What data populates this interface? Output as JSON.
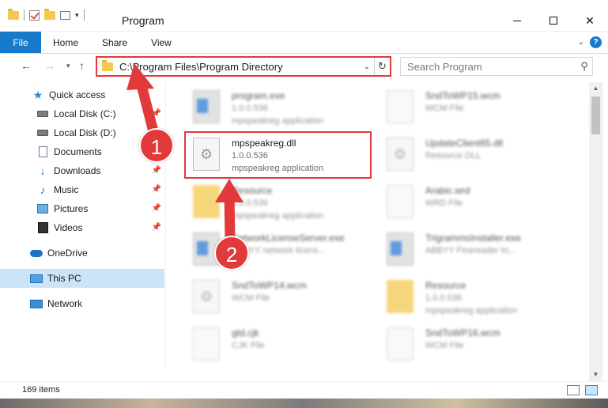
{
  "window": {
    "title": "Program"
  },
  "ribbon": {
    "tabs": [
      "File",
      "Home",
      "Share",
      "View"
    ]
  },
  "nav": {
    "address": "C:\\Program Files\\Program Directory",
    "search_placeholder": "Search Program"
  },
  "sidebar": {
    "items": [
      {
        "label": "Quick access",
        "icon": "star-icon",
        "pinned": false
      },
      {
        "label": "Local Disk (C:)",
        "icon": "disk-icon",
        "pinned": true
      },
      {
        "label": "Local Disk (D:)",
        "icon": "disk-icon",
        "pinned": false
      },
      {
        "label": "Documents",
        "icon": "documents-icon",
        "pinned": true
      },
      {
        "label": "Downloads",
        "icon": "downloads-icon",
        "pinned": true
      },
      {
        "label": "Music",
        "icon": "music-icon",
        "pinned": true
      },
      {
        "label": "Pictures",
        "icon": "pictures-icon",
        "pinned": true
      },
      {
        "label": "Videos",
        "icon": "videos-icon",
        "pinned": true
      },
      {
        "label": "OneDrive",
        "icon": "onedrive-icon",
        "pinned": false
      },
      {
        "label": "This PC",
        "icon": "this-pc-icon",
        "pinned": false,
        "selected": true
      },
      {
        "label": "Network",
        "icon": "network-icon",
        "pinned": false
      }
    ]
  },
  "files": {
    "highlighted": {
      "name": "mpspeakreg.dll",
      "version": "1.0.0.536",
      "type": "mpspeakreg application"
    },
    "others": [
      {
        "name": "program.exe",
        "sub1": "1.0.0.536",
        "sub2": "mpspeakreg application"
      },
      {
        "name": "SndToWP15.wcm",
        "sub1": "WCM File",
        "sub2": ""
      },
      {
        "name": "UpdateClient65.dll",
        "sub1": "Resource DLL",
        "sub2": ""
      },
      {
        "name": "Resource",
        "sub1": "1.0.0.536",
        "sub2": "mpspeakreg application"
      },
      {
        "name": "Arabic.wrd",
        "sub1": "WRD File",
        "sub2": ""
      },
      {
        "name": "NetworkLicenseServer.exe",
        "sub1": "ABBYY network licens...",
        "sub2": ""
      },
      {
        "name": "TrigrammsInstaller.exe",
        "sub1": "ABBYY Finereader tri...",
        "sub2": ""
      },
      {
        "name": "SndToWP14.wcm",
        "sub1": "WCM File",
        "sub2": ""
      },
      {
        "name": "Resource",
        "sub1": "1.0.0.536",
        "sub2": "mpspeakreg application"
      },
      {
        "name": "gtd.cjk",
        "sub1": "CJK File",
        "sub2": ""
      },
      {
        "name": "SndToWP16.wcm",
        "sub1": "WCM File",
        "sub2": ""
      }
    ]
  },
  "status": {
    "item_count": "169 items"
  },
  "annotations": {
    "step1": "1",
    "step2": "2",
    "color": "#e23a3a"
  }
}
